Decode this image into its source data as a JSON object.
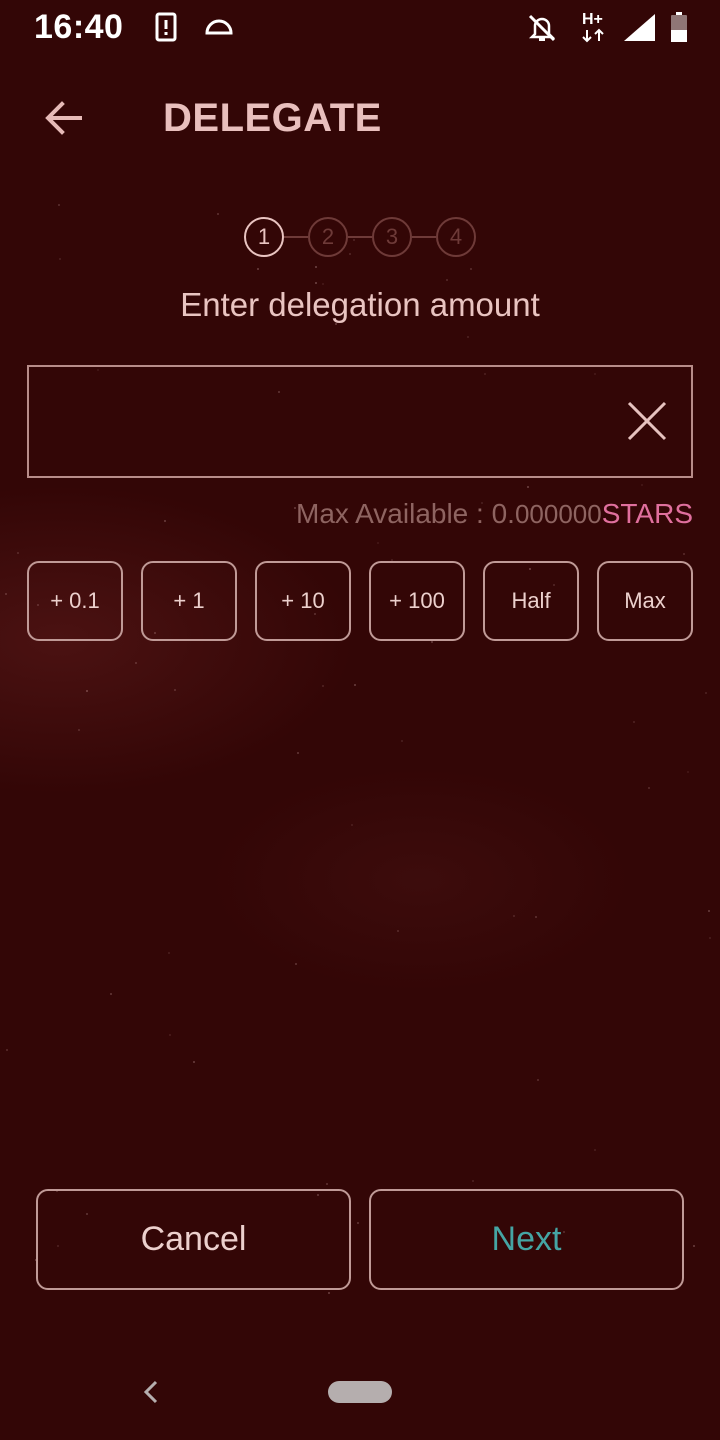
{
  "status_bar": {
    "time": "16:40"
  },
  "header": {
    "title": "DELEGATE"
  },
  "stepper": {
    "steps": [
      "1",
      "2",
      "3",
      "4"
    ],
    "active_step": 1
  },
  "form": {
    "prompt": "Enter delegation amount",
    "amount_value": "",
    "max_label": "Max Available : ",
    "max_value_int": "0.",
    "max_value_dec": "000000",
    "max_unit": "STARS"
  },
  "quick_buttons": [
    "+ 0.1",
    "+ 1",
    "+ 10",
    "+ 100",
    "Half",
    "Max"
  ],
  "actions": {
    "cancel": "Cancel",
    "next": "Next"
  },
  "colors": {
    "background": "#330606",
    "accent_pink": "#e0709e",
    "accent_teal": "#45a5a4",
    "muted": "#8e6461"
  },
  "icons": {
    "back": "arrow-left-icon",
    "clear": "close-icon"
  }
}
